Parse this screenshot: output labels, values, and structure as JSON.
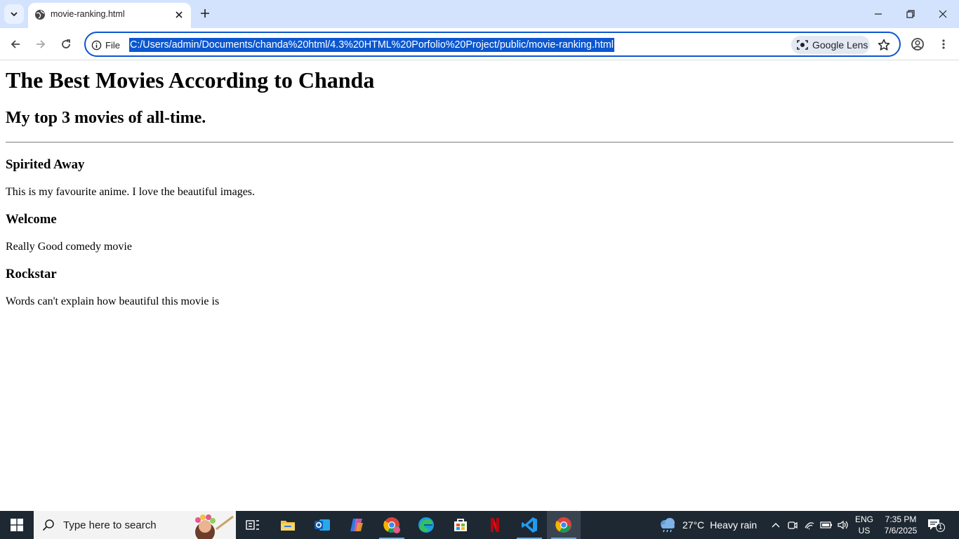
{
  "browser": {
    "tab": {
      "title": "movie-ranking.html"
    },
    "omnibox": {
      "site_info_label": "File",
      "url": "C:/Users/admin/Documents/chanda%20html/4.3%20HTML%20Porfolio%20Project/public/movie-ranking.html"
    },
    "lens_label": "Google Lens"
  },
  "page": {
    "heading": "The Best Movies According to Chanda",
    "subheading": "My top 3 movies of all-time.",
    "movies": [
      {
        "title": "Spirited Away",
        "description": "This is my favourite anime. I love the beautiful images."
      },
      {
        "title": "Welcome",
        "description": "Really Good comedy movie"
      },
      {
        "title": "Rockstar",
        "description": "Words can't explain how beautiful this movie is"
      }
    ]
  },
  "taskbar": {
    "search_placeholder": "Type here to search",
    "weather": {
      "temp": "27°C",
      "condition": "Heavy rain"
    },
    "language": {
      "line1": "ENG",
      "line2": "US"
    },
    "clock": {
      "time": "7:35 PM",
      "date": "7/6/2025"
    },
    "notification_count": "1",
    "apps": [
      "task-view",
      "file-explorer",
      "outlook",
      "copilot",
      "chrome-profile",
      "edge",
      "microsoft-store",
      "netflix",
      "vscode",
      "chrome"
    ]
  }
}
